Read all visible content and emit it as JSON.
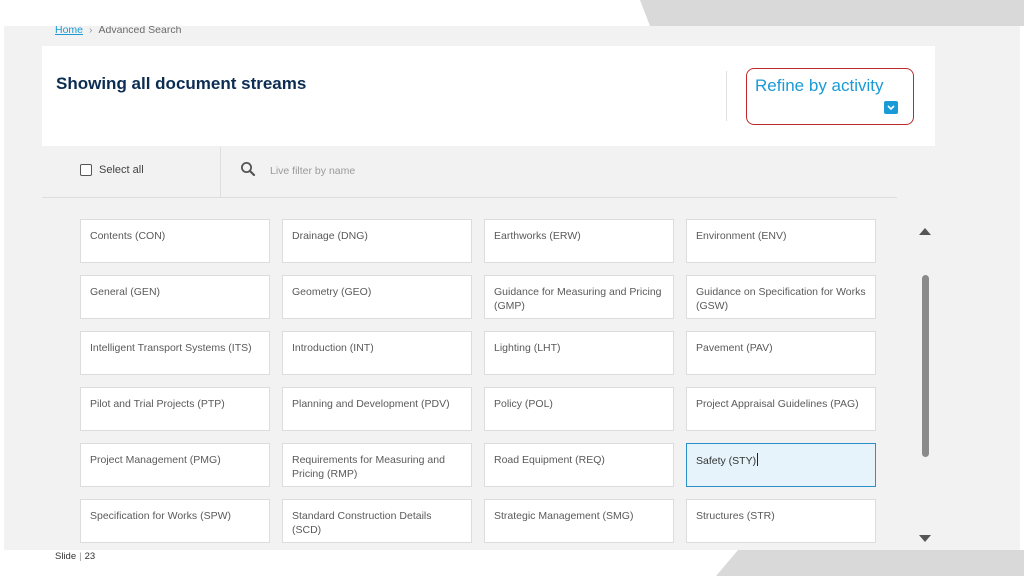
{
  "breadcrumb": {
    "home": "Home",
    "current": "Advanced Search"
  },
  "header": {
    "title": "Showing all document streams",
    "refine_label": "Refine by activity"
  },
  "filter": {
    "select_all_label": "Select all",
    "search_placeholder": "Live filter by name"
  },
  "streams": [
    "Contents (CON)",
    "Drainage (DNG)",
    "Earthworks (ERW)",
    "Environment (ENV)",
    "General (GEN)",
    "Geometry (GEO)",
    "Guidance for Measuring and Pricing (GMP)",
    "Guidance on Specification for Works (GSW)",
    "Intelligent Transport Systems (ITS)",
    "Introduction (INT)",
    "Lighting (LHT)",
    "Pavement (PAV)",
    "Pilot and Trial Projects (PTP)",
    "Planning and Development (PDV)",
    "Policy (POL)",
    "Project Appraisal Guidelines (PAG)",
    "Project Management (PMG)",
    "Requirements for Measuring and Pricing (RMP)",
    "Road Equipment (REQ)",
    "Safety (STY)",
    "Specification for Works (SPW)",
    "Standard Construction Details (SCD)",
    "Strategic Management (SMG)",
    "Structures (STR)"
  ],
  "selected_stream": "Safety (STY)",
  "footer": {
    "label": "Slide",
    "number": "23"
  },
  "colors": {
    "accent": "#1a9bd7",
    "title": "#0c2d53",
    "highlight_border": "#c0282d",
    "selected_border": "#2b8fc9"
  },
  "icons": {
    "search": "search-icon",
    "chevron": "chevron-down-icon",
    "scroll_up": "triangle-up-icon",
    "scroll_down": "triangle-down-icon"
  }
}
